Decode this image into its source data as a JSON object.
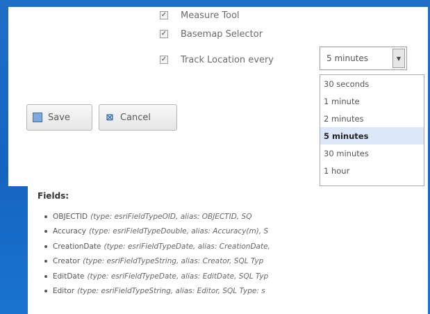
{
  "options": [
    {
      "label": "Measure Tool",
      "checked": "✓"
    },
    {
      "label": "Basemap Selector",
      "checked": "✓"
    },
    {
      "label": "Track Location every",
      "checked": "✓"
    }
  ],
  "track_interval": {
    "selected": "5 minutes",
    "arrow": "▼",
    "options": [
      "30 seconds",
      "1 minute",
      "2 minutes",
      "5 minutes",
      "30 minutes",
      "1 hour"
    ]
  },
  "buttons": {
    "save_label": "Save",
    "cancel_label": "Cancel",
    "save_icon": "disk-icon",
    "cancel_icon": "cancel-icon"
  },
  "fields": {
    "title": "Fields:",
    "items": [
      {
        "name": "OBJECTID",
        "desc": "(type: esriFieldTypeOID, alias: OBJECTID, SQ"
      },
      {
        "name": "Accuracy",
        "desc": "(type: esriFieldTypeDouble, alias: Accuracy(m), S"
      },
      {
        "name": "CreationDate",
        "desc": "(type: esriFieldTypeDate, alias: CreationDate,"
      },
      {
        "name": "Creator",
        "desc": "(type: esriFieldTypeString, alias: Creator, SQL Typ"
      },
      {
        "name": "EditDate",
        "desc": "(type: esriFieldTypeDate, alias: EditDate, SQL Typ"
      },
      {
        "name": "Editor",
        "desc": "(type: esriFieldTypeString, alias: Editor, SQL Type: s"
      }
    ]
  }
}
